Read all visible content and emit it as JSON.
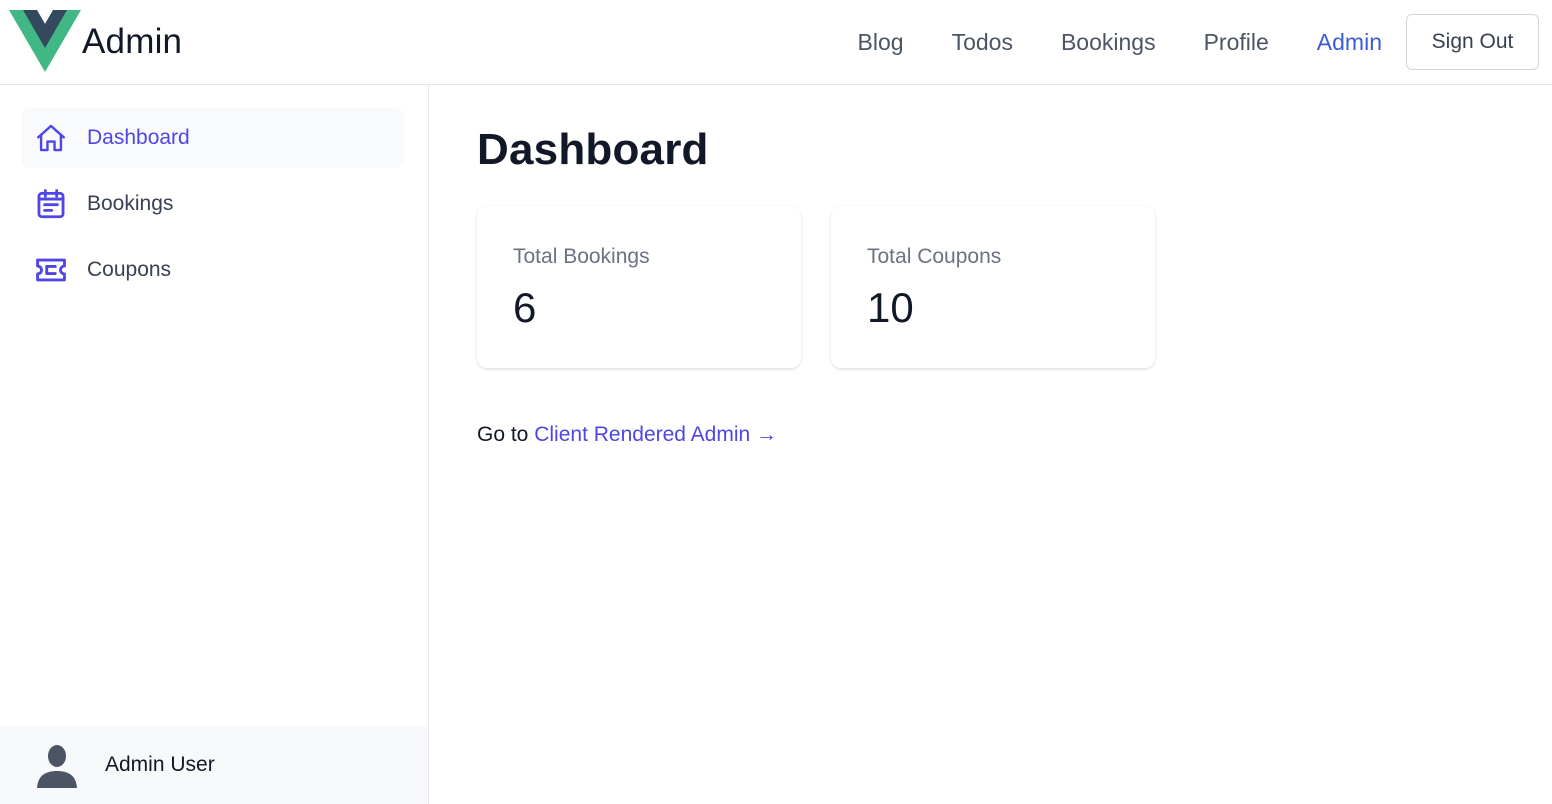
{
  "header": {
    "brand_title": "Admin",
    "nav": [
      {
        "label": "Blog",
        "active": false
      },
      {
        "label": "Todos",
        "active": false
      },
      {
        "label": "Bookings",
        "active": false
      },
      {
        "label": "Profile",
        "active": false
      },
      {
        "label": "Admin",
        "active": true
      }
    ],
    "signout_label": "Sign Out"
  },
  "sidebar": {
    "items": [
      {
        "label": "Dashboard",
        "icon": "home-icon",
        "active": true
      },
      {
        "label": "Bookings",
        "icon": "calendar-icon",
        "active": false
      },
      {
        "label": "Coupons",
        "icon": "ticket-icon",
        "active": false
      }
    ],
    "user": {
      "name": "Admin User",
      "icon": "user-avatar-icon"
    }
  },
  "main": {
    "title": "Dashboard",
    "stats": [
      {
        "label": "Total Bookings",
        "value": "6"
      },
      {
        "label": "Total Coupons",
        "value": "10"
      }
    ],
    "goto": {
      "prefix": "Go to",
      "link_label": "Client Rendered Admin →"
    }
  },
  "colors": {
    "accent": "#4f46e5",
    "nav_active": "#3b5bdb",
    "logo_green": "#41b883",
    "logo_dark": "#35495e",
    "sidebar_active_bg": "#f9fafb",
    "user_footer_bg": "#f8f9fb"
  }
}
